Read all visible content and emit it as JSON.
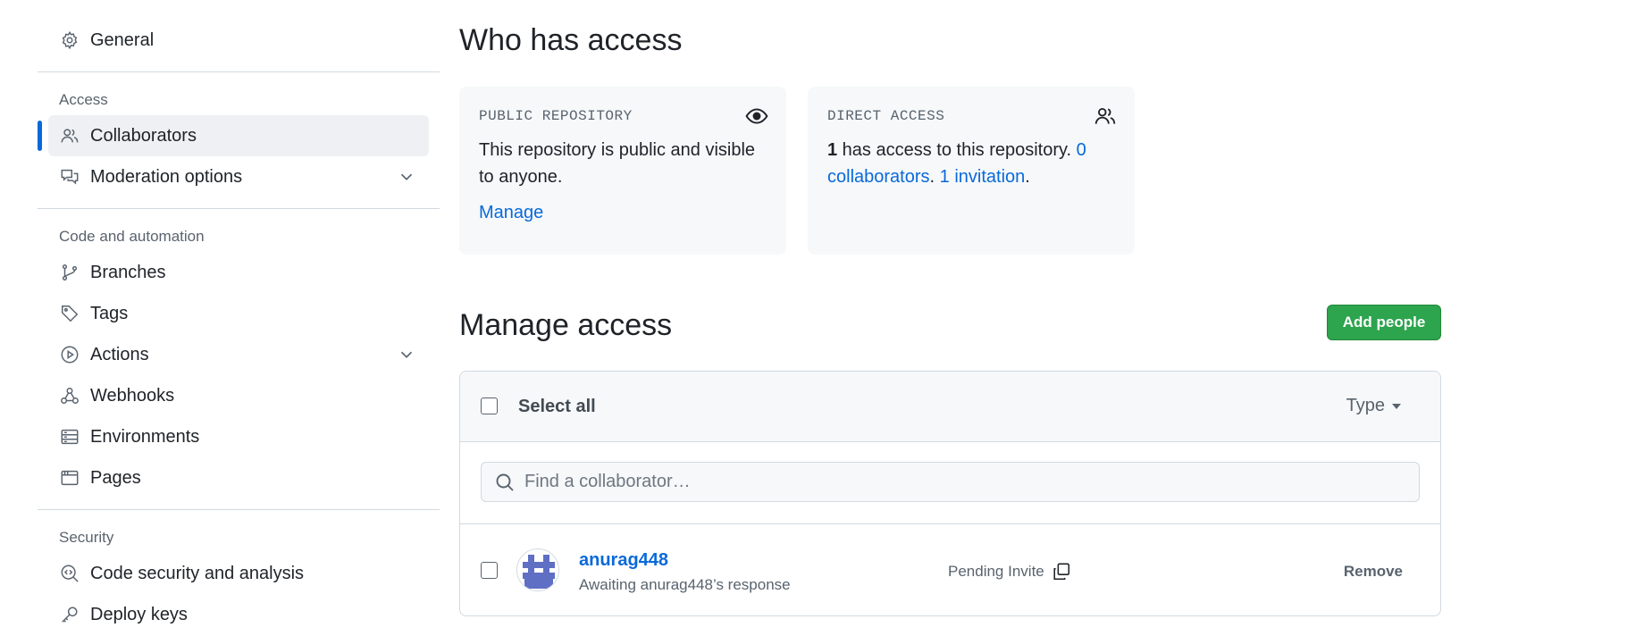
{
  "sidebar": {
    "general_label": "General",
    "access_heading": "Access",
    "collaborators_label": "Collaborators",
    "moderation_label": "Moderation options",
    "code_heading": "Code and automation",
    "branches_label": "Branches",
    "tags_label": "Tags",
    "actions_label": "Actions",
    "webhooks_label": "Webhooks",
    "environments_label": "Environments",
    "pages_label": "Pages",
    "security_heading": "Security",
    "code_security_label": "Code security and analysis",
    "deploy_keys_label": "Deploy keys"
  },
  "who_has_access": {
    "title": "Who has access",
    "public_card": {
      "kicker": "PUBLIC REPOSITORY",
      "icon": "eye-icon",
      "text": "This repository is public and visible to anyone.",
      "manage_label": "Manage"
    },
    "direct_card": {
      "kicker": "DIRECT ACCESS",
      "icon": "people-icon",
      "count": "1",
      "text": " has access to this repository. ",
      "collaborators_link": "0 collaborators",
      "sep": ". ",
      "invitations_link": "1 invitation",
      "end": "."
    }
  },
  "manage_access": {
    "title": "Manage access",
    "add_people_label": "Add people",
    "select_all_label": "Select all",
    "type_label": "Type",
    "search_placeholder": "Find a collaborator…",
    "rows": [
      {
        "username": "anurag448",
        "subtitle": "Awaiting anurag448’s response",
        "status": "Pending Invite",
        "remove_label": "Remove"
      }
    ]
  },
  "colors": {
    "accent": "#0969da",
    "button_green": "#2da44e",
    "avatar": "#5f6fc4"
  }
}
